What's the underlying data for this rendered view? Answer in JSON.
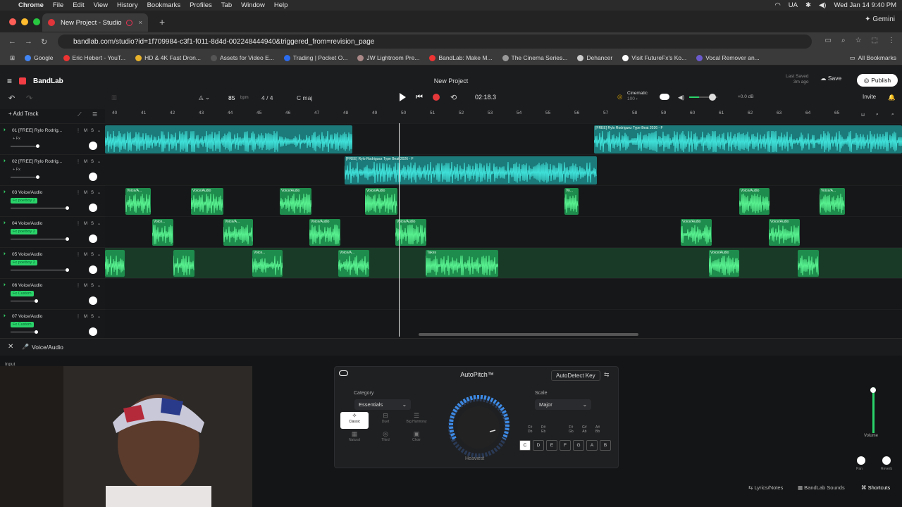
{
  "menubar": {
    "app": "Chrome",
    "items": [
      "File",
      "Edit",
      "View",
      "History",
      "Bookmarks",
      "Profiles",
      "Tab",
      "Window",
      "Help"
    ],
    "lang": "UA",
    "datetime": "Wed Jan 14  9:40 PM"
  },
  "browser": {
    "tab_title": "New Project - Studio",
    "url": "bandlab.com/studio?id=1f709984-c3f1-f011-8d4d-002248444940&triggered_from=revision_page",
    "gemini": "Gemini",
    "bookmarks": [
      {
        "label": "Google",
        "color": "#4285f4"
      },
      {
        "label": "Eric Hebert - YouT...",
        "color": "#e33"
      },
      {
        "label": "HD & 4K Fast Dron...",
        "color": "#e8b22a"
      },
      {
        "label": "Assets for Video E...",
        "color": "#555"
      },
      {
        "label": "Trading | Pocket O...",
        "color": "#2b6cf0"
      },
      {
        "label": "JW Lightroom Pre...",
        "color": "#a88"
      },
      {
        "label": "BandLab: Make M...",
        "color": "#e33"
      },
      {
        "label": "The Cinema Series...",
        "color": "#999"
      },
      {
        "label": "Dehancer",
        "color": "#ccc"
      },
      {
        "label": "Visit FutureFx's Ko...",
        "color": "#fff"
      },
      {
        "label": "Vocal Remover an...",
        "color": "#6a5acd"
      }
    ],
    "all_bookmarks": "All Bookmarks"
  },
  "header": {
    "brand": "BandLab",
    "project": "New Project",
    "last_saved": "Last Saved",
    "saved_ago": "3m ago",
    "save": "Save",
    "publish": "Publish",
    "tempo": "85",
    "bpm": "bpm",
    "timesig": "4 / 4",
    "key": "C maj",
    "time": "02:18.3",
    "preset": "Cinematic",
    "preset_val": "100 ›",
    "db": "+0.0 dB",
    "invite": "Invite"
  },
  "tracks": {
    "add": "Add Track",
    "items": [
      {
        "name": "01  [FREE] Rylo Rodrig...",
        "fx": "+ Fx"
      },
      {
        "name": "02  [FREE] Rylo Rodrig...",
        "fx": "+ Fx"
      },
      {
        "name": "03  Voice/Audio",
        "fx": "Fx  poetboy 2"
      },
      {
        "name": "04  Voice/Audio",
        "fx": "Fx  poetboy 2"
      },
      {
        "name": "05  Voice/Audio",
        "fx": "Fx  poetboy 2"
      },
      {
        "name": "06  Voice/Audio",
        "fx": "Fx  Custom"
      },
      {
        "name": "07  Voice/Audio",
        "fx": "Fx  Custom"
      }
    ]
  },
  "ruler": [
    "40",
    "41",
    "42",
    "43",
    "44",
    "45",
    "46",
    "47",
    "48",
    "49",
    "50",
    "51",
    "52",
    "53",
    "54",
    "55",
    "56",
    "57",
    "58",
    "59",
    "60",
    "61",
    "62",
    "63",
    "64",
    "65"
  ],
  "clips": {
    "beat_a": "[FREE] Rylo Rodriguez Type Beat 2026 - F",
    "beat_b": "[FREE] Rylo Rodriguez Type Beat 2026 - F",
    "voice": "Voice/Audio",
    "voice_a": "Voice/A...",
    "voice_short": "Voice...",
    "vo": "Vo...",
    "takes": "Takes"
  },
  "detail": {
    "track": "Voice/Audio",
    "input": "Input"
  },
  "autopitch": {
    "title": "AutoPitch™",
    "autodetect": "AutoDetect Key",
    "category_label": "Category",
    "category": "Essentials",
    "scale_label": "Scale",
    "scale": "Major",
    "modes": [
      "Classic",
      "Duet",
      "Big Harmony",
      "Natural",
      "Third",
      "Choir"
    ],
    "heaviest": "Heaviest",
    "sharps": [
      "C#\nDb",
      "D#\nEb",
      "F#\nGb",
      "G#\nAb",
      "A#\nBb"
    ],
    "keys": [
      "C",
      "D",
      "E",
      "F",
      "G",
      "A",
      "B"
    ]
  },
  "mixer": {
    "volume": "Volume",
    "pan": "Pan",
    "reverb": "Reverb"
  },
  "footer": {
    "lyrics": "Lyrics/Notes",
    "sounds": "BandLab Sounds",
    "shortcuts": "Shortcuts"
  }
}
